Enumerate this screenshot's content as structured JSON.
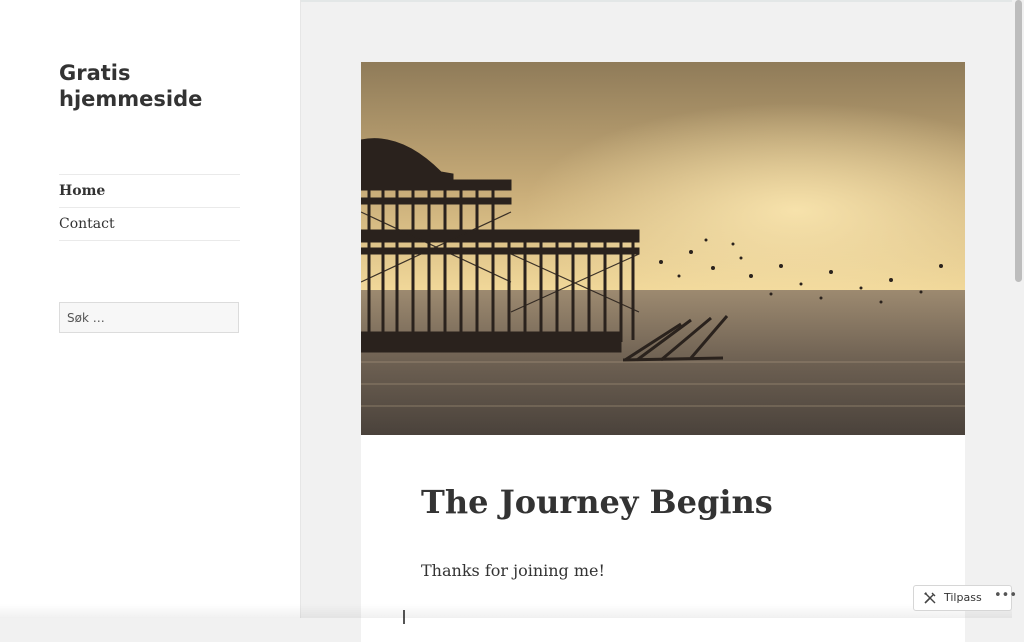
{
  "site": {
    "title": "Gratis hjemmeside"
  },
  "menu": {
    "items": [
      {
        "label": "Home",
        "active": true
      },
      {
        "label": "Contact",
        "active": false
      }
    ]
  },
  "search": {
    "placeholder": "Søk …"
  },
  "post": {
    "title": "The Journey Begins",
    "text": "Thanks for joining me!",
    "image": "sunset-pier-photo"
  },
  "customize": {
    "label": "Tilpass",
    "more": "•••"
  },
  "colors": {
    "sidebar_bg": "#ffffff",
    "page_bg": "#f1f1f1",
    "text": "#333333",
    "sky_top": "#8f7b59",
    "sky_glow": "#f2d99a",
    "water": "#5b5148"
  }
}
